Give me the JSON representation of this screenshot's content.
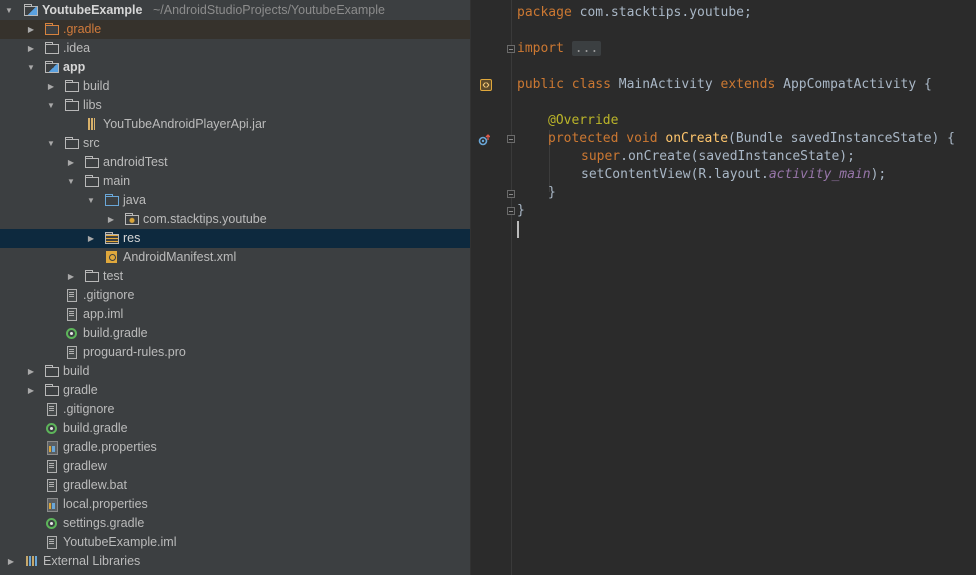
{
  "project_tree": {
    "root": {
      "name": "YoutubeExample",
      "path": "~/AndroidStudioProjects/YoutubeExample"
    },
    "items": [
      {
        "label": ".gradle"
      },
      {
        "label": ".idea"
      },
      {
        "label": "app"
      },
      {
        "label": "build"
      },
      {
        "label": "libs"
      },
      {
        "label": "YouTubeAndroidPlayerApi.jar"
      },
      {
        "label": "src"
      },
      {
        "label": "androidTest"
      },
      {
        "label": "main"
      },
      {
        "label": "java"
      },
      {
        "label": "com.stacktips.youtube"
      },
      {
        "label": "res"
      },
      {
        "label": "AndroidManifest.xml"
      },
      {
        "label": "test"
      },
      {
        "label": ".gitignore"
      },
      {
        "label": "app.iml"
      },
      {
        "label": "build.gradle"
      },
      {
        "label": "proguard-rules.pro"
      },
      {
        "label": "build"
      },
      {
        "label": "gradle"
      },
      {
        "label": ".gitignore"
      },
      {
        "label": "build.gradle"
      },
      {
        "label": "gradle.properties"
      },
      {
        "label": "gradlew"
      },
      {
        "label": "gradlew.bat"
      },
      {
        "label": "local.properties"
      },
      {
        "label": "settings.gradle"
      },
      {
        "label": "YoutubeExample.iml"
      },
      {
        "label": "External Libraries"
      }
    ]
  },
  "editor": {
    "code": {
      "package_kw": "package",
      "package_name": " com.stacktips.youtube;",
      "import_kw": "import",
      "import_fold": "...",
      "class_decl": [
        "public class",
        " MainActivity ",
        "extends",
        " AppCompatActivity {"
      ],
      "override": "@Override",
      "method_decl": [
        "protected void",
        " ",
        "onCreate",
        "(Bundle savedInstanceState) {"
      ],
      "super_call": [
        "super",
        ".onCreate(savedInstanceState);"
      ],
      "set_content": [
        "setContentView(R.layout.",
        "activity_main",
        ");"
      ],
      "close_method": "}",
      "close_class": "}"
    },
    "colors": {
      "keyword": "#cc7832",
      "annotation": "#bbb529",
      "method": "#ffc66d",
      "field_italic": "#9876aa",
      "text": "#a9b7c6",
      "background": "#2b2b2b"
    }
  }
}
